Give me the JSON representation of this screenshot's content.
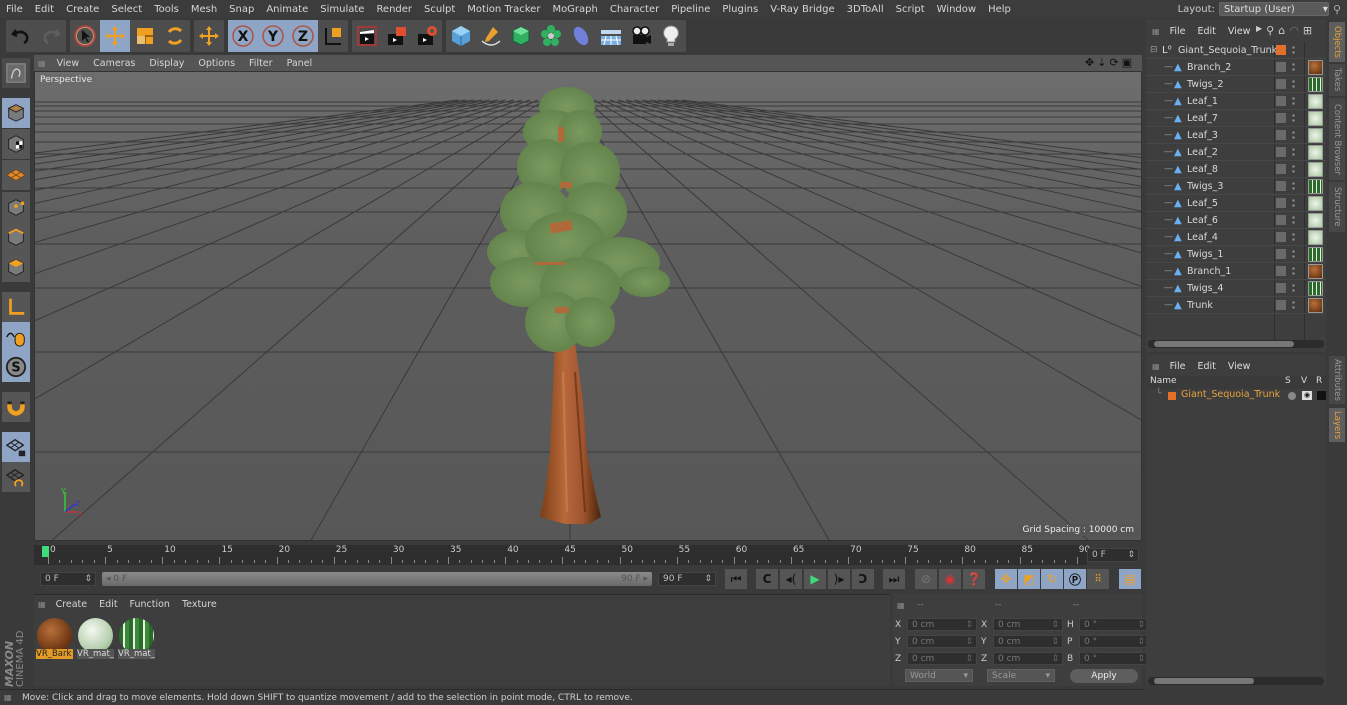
{
  "menubar": {
    "items": [
      "File",
      "Edit",
      "Create",
      "Select",
      "Tools",
      "Mesh",
      "Snap",
      "Animate",
      "Simulate",
      "Render",
      "Sculpt",
      "Motion Tracker",
      "MoGraph",
      "Character",
      "Pipeline",
      "Plugins",
      "V-Ray Bridge",
      "3DToAll",
      "Script",
      "Window",
      "Help"
    ],
    "layout_label": "Layout:",
    "layout_value": "Startup (User)"
  },
  "toolbar": {
    "tools": [
      "undo-icon",
      "redo-icon",
      "live-selection-icon",
      "move-icon",
      "scale-icon",
      "rotate-icon",
      "recent-tools-icon",
      "x-axis-lock-icon",
      "y-axis-lock-icon",
      "z-axis-lock-icon",
      "coordinate-system-icon",
      "render-view-icon",
      "render-picture-viewer-icon",
      "render-settings-icon",
      "cube-icon",
      "pen-icon",
      "subdivision-icon",
      "cloner-icon",
      "deformer-icon",
      "floor-icon",
      "camera-icon",
      "light-icon"
    ],
    "axis_labels": [
      "X",
      "Y",
      "Z"
    ]
  },
  "viewport": {
    "menu": [
      "View",
      "Cameras",
      "Display",
      "Options",
      "Filter",
      "Panel"
    ],
    "camera_label": "Perspective",
    "grid_spacing": "Grid Spacing : 10000 cm"
  },
  "timeline": {
    "ticks": [
      "0",
      "5",
      "10",
      "15",
      "20",
      "25",
      "30",
      "35",
      "40",
      "45",
      "50",
      "55",
      "60",
      "65",
      "70",
      "75",
      "80",
      "85",
      "90"
    ],
    "current_frame": "0 F",
    "start_frame": "0 F",
    "range_start": "0 F",
    "range_end": "90 F",
    "end_frame": "90 F"
  },
  "materials": {
    "menu": [
      "Create",
      "Edit",
      "Function",
      "Texture"
    ],
    "items": [
      {
        "name": "VR_Bark",
        "type": "bark",
        "selected": true
      },
      {
        "name": "VR_mat_",
        "type": "leaf",
        "selected": false
      },
      {
        "name": "VR_mat_",
        "type": "twig",
        "selected": false
      }
    ],
    "brand_line1": "MAXON",
    "brand_line2": "CINEMA 4D"
  },
  "coordinates": {
    "headers": [
      "--",
      "--",
      "--"
    ],
    "rows": [
      {
        "a": "X",
        "av": "0 cm",
        "b": "X",
        "bv": "0 cm",
        "c": "H",
        "cv": "0 °"
      },
      {
        "a": "Y",
        "av": "0 cm",
        "b": "Y",
        "bv": "0 cm",
        "c": "P",
        "cv": "0 °"
      },
      {
        "a": "Z",
        "av": "0 cm",
        "b": "Z",
        "bv": "0 cm",
        "c": "B",
        "cv": "0 °"
      }
    ],
    "space": "World",
    "mode": "Scale",
    "apply": "Apply"
  },
  "status": "Move: Click and drag to move elements. Hold down SHIFT to quantize movement / add to the selection in point mode, CTRL to remove.",
  "objects": {
    "menu": [
      "File",
      "Edit",
      "View"
    ],
    "root": "Giant_Sequoia_Trunk",
    "children": [
      {
        "name": "Branch_2",
        "mat": "bark"
      },
      {
        "name": "Twigs_2",
        "mat": "twig"
      },
      {
        "name": "Leaf_1",
        "mat": "leaf"
      },
      {
        "name": "Leaf_7",
        "mat": "leaf"
      },
      {
        "name": "Leaf_3",
        "mat": "leaf"
      },
      {
        "name": "Leaf_2",
        "mat": "leaf"
      },
      {
        "name": "Leaf_8",
        "mat": "leaf"
      },
      {
        "name": "Twigs_3",
        "mat": "twig"
      },
      {
        "name": "Leaf_5",
        "mat": "leaf"
      },
      {
        "name": "Leaf_6",
        "mat": "leaf"
      },
      {
        "name": "Leaf_4",
        "mat": "leaf"
      },
      {
        "name": "Twigs_1",
        "mat": "twig"
      },
      {
        "name": "Branch_1",
        "mat": "bark"
      },
      {
        "name": "Twigs_4",
        "mat": "twig"
      },
      {
        "name": "Trunk",
        "mat": "bark"
      }
    ]
  },
  "layers": {
    "menu": [
      "File",
      "Edit",
      "View"
    ],
    "columns": [
      "Name",
      "S",
      "V",
      "R"
    ],
    "items": [
      {
        "name": "Giant_Sequoia_Trunk",
        "color": "#e0702a"
      }
    ]
  },
  "right_tabs": {
    "top": [
      "Objects",
      "Takes",
      "Content Browser",
      "Structure"
    ],
    "bottom": [
      "Attributes",
      "Layers"
    ]
  },
  "colors": {
    "accent": "#e7a33b",
    "active_button": "#8fa5c6",
    "layer_color": "#e0702a"
  }
}
